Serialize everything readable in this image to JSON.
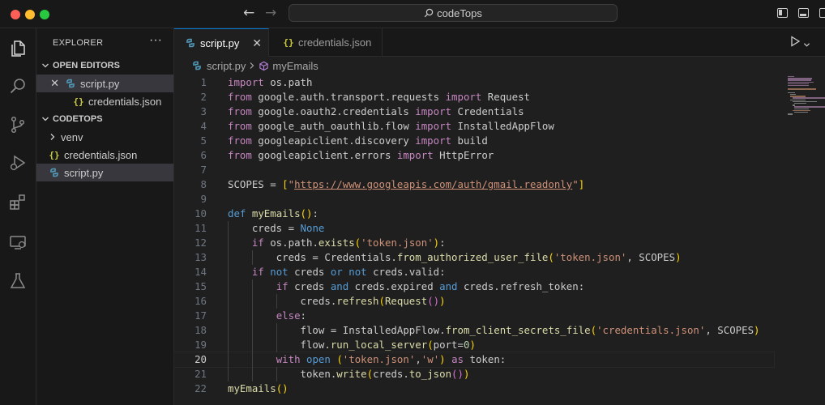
{
  "window": {
    "title": "codeTops"
  },
  "activity_bar": {
    "items": [
      "files-icon",
      "search-icon",
      "source-control-icon",
      "run-debug-icon",
      "extensions-icon",
      "remote-explorer-icon",
      "testing-icon"
    ]
  },
  "sidebar": {
    "title": "EXPLORER",
    "more": "···",
    "open_editors": {
      "label": "OPEN EDITORS",
      "items": [
        {
          "label": "script.py",
          "icon": "python-file-icon",
          "selected": true
        },
        {
          "label": "credentials.json",
          "icon": "json-file-icon",
          "selected": false
        }
      ]
    },
    "folder": {
      "label": "CODETOPS",
      "items": [
        {
          "label": "venv",
          "type": "folder"
        },
        {
          "label": "credentials.json",
          "type": "json"
        },
        {
          "label": "script.py",
          "type": "python",
          "selected": true
        }
      ]
    }
  },
  "tabs": [
    {
      "label": "script.py",
      "active": true,
      "close": "✕"
    },
    {
      "label": "credentials.json",
      "active": false
    }
  ],
  "breadcrumb": {
    "file": "script.py",
    "symbol": "myEmails"
  },
  "editor": {
    "active_line": 20,
    "lines": [
      {
        "n": "1",
        "code": "import os.path"
      },
      {
        "n": "2",
        "code": "from google.auth.transport.requests import Request"
      },
      {
        "n": "3",
        "code": "from google.oauth2.credentials import Credentials"
      },
      {
        "n": "4",
        "code": "from google_auth_oauthlib.flow import InstalledAppFlow"
      },
      {
        "n": "5",
        "code": "from googleapiclient.discovery import build"
      },
      {
        "n": "6",
        "code": "from googleapiclient.errors import HttpError"
      },
      {
        "n": "7",
        "code": ""
      },
      {
        "n": "8",
        "code": "SCOPES = [\"https://www.googleapis.com/auth/gmail.readonly\"]"
      },
      {
        "n": "9",
        "code": ""
      },
      {
        "n": "10",
        "code": "def myEmails():"
      },
      {
        "n": "11",
        "code": "    creds = None"
      },
      {
        "n": "12",
        "code": "    if os.path.exists('token.json'):"
      },
      {
        "n": "13",
        "code": "        creds = Credentials.from_authorized_user_file('token.json', SCOPES)"
      },
      {
        "n": "14",
        "code": "    if not creds or not creds.valid:"
      },
      {
        "n": "15",
        "code": "        if creds and creds.expired and creds.refresh_token:"
      },
      {
        "n": "16",
        "code": "            creds.refresh(Request())"
      },
      {
        "n": "17",
        "code": "        else:"
      },
      {
        "n": "18",
        "code": "            flow = InstalledAppFlow.from_client_secrets_file('credentials.json', SCOPES)"
      },
      {
        "n": "19",
        "code": "            flow.run_local_server(port=0)"
      },
      {
        "n": "20",
        "code": "        with open ('token.json','w') as token:"
      },
      {
        "n": "21",
        "code": "            token.write(creds.to_json())"
      },
      {
        "n": "22",
        "code": "myEmails()"
      }
    ]
  },
  "colors": {
    "accent": "#0078d4",
    "keyword": "#c586c0",
    "string": "#ce9178",
    "function": "#dcdcaa"
  }
}
